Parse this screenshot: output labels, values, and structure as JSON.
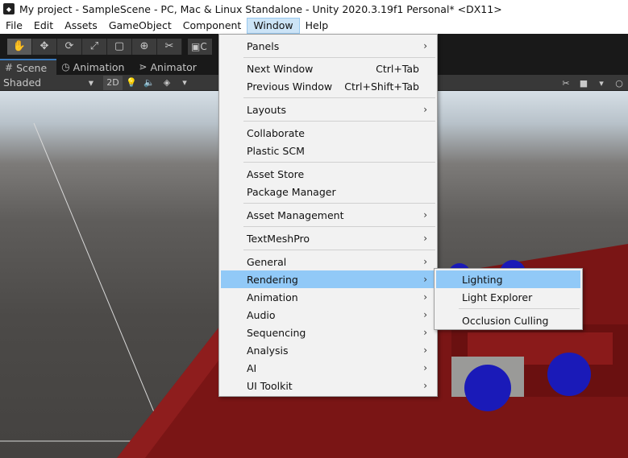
{
  "titlebar": {
    "title": "My project - SampleScene - PC, Mac & Linux Standalone - Unity 2020.3.19f1 Personal* <DX11>"
  },
  "menubar": {
    "items": [
      "File",
      "Edit",
      "Assets",
      "GameObject",
      "Component",
      "Window",
      "Help"
    ]
  },
  "toolbar": {
    "tools": [
      "hand-tool",
      "move-tool",
      "rotate-tool",
      "scale-tool",
      "rect-tool",
      "transform-tool",
      "custom-tool"
    ],
    "collab_label": "C"
  },
  "tabs": [
    {
      "label": "Scene",
      "icon": "grid-icon"
    },
    {
      "label": "Animation",
      "icon": "clock-icon"
    },
    {
      "label": "Animator",
      "icon": "animator-icon"
    }
  ],
  "scenebar": {
    "shading_mode": "Shaded",
    "mode_2d": "2D"
  },
  "window_menu": {
    "items": [
      {
        "label": "Panels",
        "shortcut": "",
        "submenu": true
      },
      {
        "label": "Next Window",
        "shortcut": "Ctrl+Tab",
        "submenu": false
      },
      {
        "label": "Previous Window",
        "shortcut": "Ctrl+Shift+Tab",
        "submenu": false
      },
      {
        "label": "Layouts",
        "shortcut": "",
        "submenu": true
      },
      {
        "label": "Collaborate",
        "shortcut": "",
        "submenu": false
      },
      {
        "label": "Plastic SCM",
        "shortcut": "",
        "submenu": false
      },
      {
        "label": "Asset Store",
        "shortcut": "",
        "submenu": false
      },
      {
        "label": "Package Manager",
        "shortcut": "",
        "submenu": false
      },
      {
        "label": "Asset Management",
        "shortcut": "",
        "submenu": true
      },
      {
        "label": "TextMeshPro",
        "shortcut": "",
        "submenu": true
      },
      {
        "label": "General",
        "shortcut": "",
        "submenu": true
      },
      {
        "label": "Rendering",
        "shortcut": "",
        "submenu": true,
        "highlighted": true
      },
      {
        "label": "Animation",
        "shortcut": "",
        "submenu": true
      },
      {
        "label": "Audio",
        "shortcut": "",
        "submenu": true
      },
      {
        "label": "Sequencing",
        "shortcut": "",
        "submenu": true
      },
      {
        "label": "Analysis",
        "shortcut": "",
        "submenu": true
      },
      {
        "label": "AI",
        "shortcut": "",
        "submenu": true
      },
      {
        "label": "UI Toolkit",
        "shortcut": "",
        "submenu": true
      }
    ]
  },
  "rendering_submenu": {
    "items": [
      {
        "label": "Lighting",
        "highlighted": true
      },
      {
        "label": "Light Explorer"
      },
      {
        "label": "Occlusion Culling"
      }
    ]
  },
  "colors": {
    "menu_highlight": "#91c9f7",
    "scene_floor": "#7a1515",
    "sphere": "#1a1ab8"
  }
}
